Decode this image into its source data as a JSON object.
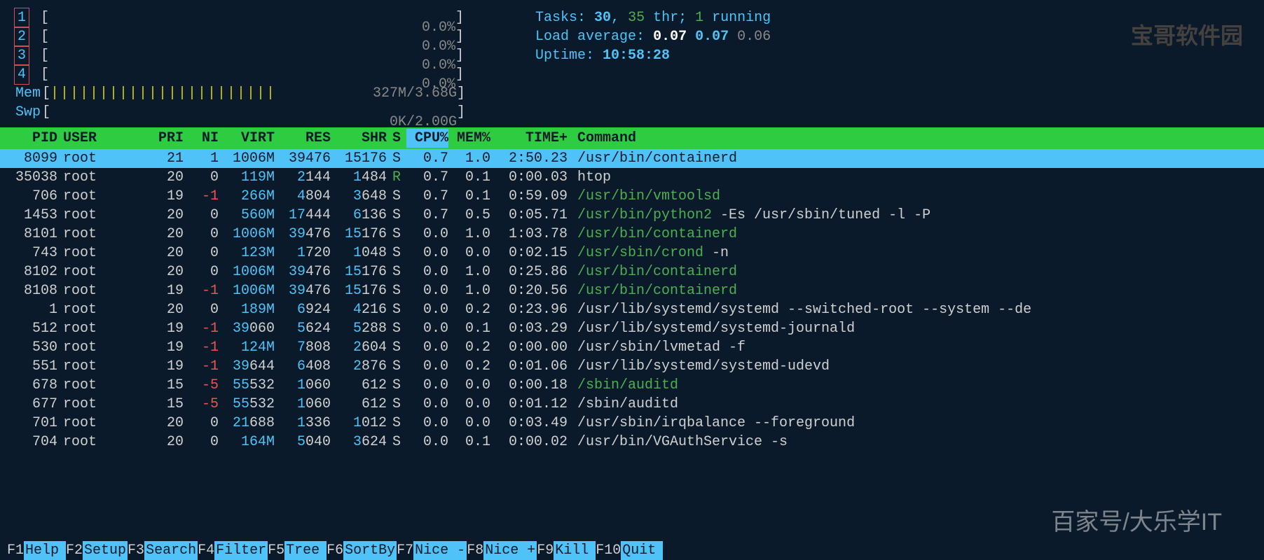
{
  "meters": {
    "cpus": [
      {
        "label": "1",
        "value": "0.0%"
      },
      {
        "label": "2",
        "value": "0.0%"
      },
      {
        "label": "3",
        "value": "0.0%"
      },
      {
        "label": "4",
        "value": "0.0%"
      }
    ],
    "mem": {
      "label": "Mem",
      "bars": "|||||||||||||||||||||||",
      "value": "327M/3.68G"
    },
    "swp": {
      "label": "Swp",
      "bars": "",
      "value": "0K/2.00G"
    }
  },
  "sysinfo": {
    "tasks_label": "Tasks: ",
    "tasks_total": "30",
    "tasks_sep": ", ",
    "tasks_thr": "35",
    "tasks_thr_label": " thr; ",
    "tasks_running": "1",
    "tasks_running_label": " running",
    "load_label": "Load average: ",
    "load1": "0.07",
    "load5": "0.07",
    "load15": "0.06",
    "uptime_label": "Uptime: ",
    "uptime": "10:58:28"
  },
  "columns": [
    "PID",
    "USER",
    "PRI",
    "NI",
    "VIRT",
    "RES",
    "SHR",
    "S",
    "CPU%",
    "MEM%",
    "TIME+",
    "Command"
  ],
  "processes": [
    {
      "pid": "8099",
      "user": "root",
      "pri": "21",
      "ni": "1",
      "virt": "1006M",
      "res": "39476",
      "shr": "15176",
      "s": "S",
      "cpu": "0.7",
      "mem": "1.0",
      "time": "2:50.23",
      "cmd": "/usr/bin/containerd",
      "green": true,
      "selected": true
    },
    {
      "pid": "35038",
      "user": "root",
      "pri": "20",
      "ni": "0",
      "virt": "119M",
      "res": "2144",
      "shr": "1484",
      "s": "R",
      "cpu": "0.7",
      "mem": "0.1",
      "time": "0:00.03",
      "cmd": "htop",
      "green": false
    },
    {
      "pid": "706",
      "user": "root",
      "pri": "19",
      "ni": "-1",
      "virt": "266M",
      "res": "4804",
      "shr": "3648",
      "s": "S",
      "cpu": "0.7",
      "mem": "0.1",
      "time": "0:59.09",
      "cmd": "/usr/bin/vmtoolsd",
      "green": true,
      "nired": true
    },
    {
      "pid": "1453",
      "user": "root",
      "pri": "20",
      "ni": "0",
      "virt": "560M",
      "res": "17444",
      "shr": "6136",
      "s": "S",
      "cpu": "0.7",
      "mem": "0.5",
      "time": "0:05.71",
      "cmd": "/usr/bin/python2 -Es /usr/sbin/tuned -l -P",
      "green": true
    },
    {
      "pid": "8101",
      "user": "root",
      "pri": "20",
      "ni": "0",
      "virt": "1006M",
      "res": "39476",
      "shr": "15176",
      "s": "S",
      "cpu": "0.0",
      "mem": "1.0",
      "time": "1:03.78",
      "cmd": "/usr/bin/containerd",
      "green": true
    },
    {
      "pid": "743",
      "user": "root",
      "pri": "20",
      "ni": "0",
      "virt": "123M",
      "res": "1720",
      "shr": "1048",
      "s": "S",
      "cpu": "0.0",
      "mem": "0.0",
      "time": "0:02.15",
      "cmd": "/usr/sbin/crond -n",
      "green": true
    },
    {
      "pid": "8102",
      "user": "root",
      "pri": "20",
      "ni": "0",
      "virt": "1006M",
      "res": "39476",
      "shr": "15176",
      "s": "S",
      "cpu": "0.0",
      "mem": "1.0",
      "time": "0:25.86",
      "cmd": "/usr/bin/containerd",
      "green": true
    },
    {
      "pid": "8108",
      "user": "root",
      "pri": "19",
      "ni": "-1",
      "virt": "1006M",
      "res": "39476",
      "shr": "15176",
      "s": "S",
      "cpu": "0.0",
      "mem": "1.0",
      "time": "0:20.56",
      "cmd": "/usr/bin/containerd",
      "green": true,
      "nired": true
    },
    {
      "pid": "1",
      "user": "root",
      "pri": "20",
      "ni": "0",
      "virt": "189M",
      "res": "6924",
      "shr": "4216",
      "s": "S",
      "cpu": "0.0",
      "mem": "0.2",
      "time": "0:23.96",
      "cmd": "/usr/lib/systemd/systemd --switched-root --system --de",
      "green": false
    },
    {
      "pid": "512",
      "user": "root",
      "pri": "19",
      "ni": "-1",
      "virt": "39060",
      "res": "5624",
      "shr": "5288",
      "s": "S",
      "cpu": "0.0",
      "mem": "0.1",
      "time": "0:03.29",
      "cmd": "/usr/lib/systemd/systemd-journald",
      "green": false,
      "nired": true,
      "virtplain": true
    },
    {
      "pid": "530",
      "user": "root",
      "pri": "19",
      "ni": "-1",
      "virt": "124M",
      "res": "7808",
      "shr": "2604",
      "s": "S",
      "cpu": "0.0",
      "mem": "0.2",
      "time": "0:00.00",
      "cmd": "/usr/sbin/lvmetad -f",
      "green": false,
      "nired": true
    },
    {
      "pid": "551",
      "user": "root",
      "pri": "19",
      "ni": "-1",
      "virt": "39644",
      "res": "6408",
      "shr": "2876",
      "s": "S",
      "cpu": "0.0",
      "mem": "0.2",
      "time": "0:01.06",
      "cmd": "/usr/lib/systemd/systemd-udevd",
      "green": false,
      "nired": true,
      "virtplain": true
    },
    {
      "pid": "678",
      "user": "root",
      "pri": "15",
      "ni": "-5",
      "virt": "55532",
      "res": "1060",
      "shr": "612",
      "s": "S",
      "cpu": "0.0",
      "mem": "0.0",
      "time": "0:00.18",
      "cmd": "/sbin/auditd",
      "green": true,
      "nired": true,
      "virtplain": true
    },
    {
      "pid": "677",
      "user": "root",
      "pri": "15",
      "ni": "-5",
      "virt": "55532",
      "res": "1060",
      "shr": "612",
      "s": "S",
      "cpu": "0.0",
      "mem": "0.0",
      "time": "0:01.12",
      "cmd": "/sbin/auditd",
      "green": false,
      "nired": true,
      "virtplain": true
    },
    {
      "pid": "701",
      "user": "root",
      "pri": "20",
      "ni": "0",
      "virt": "21688",
      "res": "1336",
      "shr": "1012",
      "s": "S",
      "cpu": "0.0",
      "mem": "0.0",
      "time": "0:03.49",
      "cmd": "/usr/sbin/irqbalance --foreground",
      "green": false,
      "virtplain": true
    },
    {
      "pid": "704",
      "user": "root",
      "pri": "20",
      "ni": "0",
      "virt": "164M",
      "res": "5040",
      "shr": "3624",
      "s": "S",
      "cpu": "0.0",
      "mem": "0.1",
      "time": "0:00.02",
      "cmd": "/usr/bin/VGAuthService -s",
      "green": false
    }
  ],
  "fkeys": [
    {
      "key": "F1",
      "label": "Help  "
    },
    {
      "key": "F2",
      "label": "Setup "
    },
    {
      "key": "F3",
      "label": "Search"
    },
    {
      "key": "F4",
      "label": "Filter"
    },
    {
      "key": "F5",
      "label": "Tree  "
    },
    {
      "key": "F6",
      "label": "SortBy"
    },
    {
      "key": "F7",
      "label": "Nice -"
    },
    {
      "key": "F8",
      "label": "Nice +"
    },
    {
      "key": "F9",
      "label": "Kill  "
    },
    {
      "key": "F10",
      "label": "Quit  "
    }
  ],
  "watermark1": "百家号/大乐学IT",
  "watermark2": "宝哥软件园"
}
